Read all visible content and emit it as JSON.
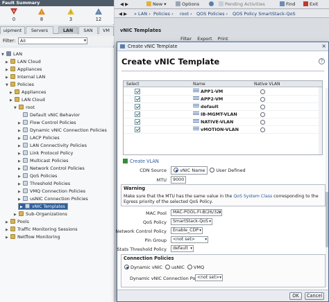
{
  "fault_summary": {
    "title": "Fault Summary",
    "items": [
      {
        "icon": "critical-icon",
        "count": "0",
        "color": "#c0392b"
      },
      {
        "icon": "major-icon",
        "count": "8",
        "color": "#e08a1e"
      },
      {
        "icon": "minor-icon",
        "count": "3",
        "color": "#e6c12a"
      },
      {
        "icon": "warning-icon",
        "count": "12",
        "color": "#5a7fae"
      }
    ]
  },
  "nav_tabs": [
    "uipment",
    "Servers",
    "LAN",
    "SAN",
    "VM"
  ],
  "active_tab": "LAN",
  "filter": {
    "label": "Filter:",
    "value": "All"
  },
  "tree": [
    {
      "label": "LAN",
      "icon": "root-icon"
    },
    {
      "label": "LAN Cloud",
      "icon": "folder-icon"
    },
    {
      "label": "Appliances",
      "icon": "folder-icon"
    },
    {
      "label": "Internal LAN",
      "icon": "folder-icon"
    },
    {
      "label": "Policies",
      "icon": "folder-icon"
    },
    {
      "label": "Appliances",
      "icon": "folder-icon"
    },
    {
      "label": "LAN Cloud",
      "icon": "folder-icon"
    },
    {
      "label": "root",
      "icon": "folder-icon"
    },
    {
      "label": "Default vNIC Behavior",
      "icon": "policy-icon"
    },
    {
      "label": "Flow Control Policies",
      "icon": "policy-icon"
    },
    {
      "label": "Dynamic vNIC Connection Policies",
      "icon": "policy-icon"
    },
    {
      "label": "LACP Policies",
      "icon": "policy-icon"
    },
    {
      "label": "LAN Connectivity Policies",
      "icon": "policy-icon"
    },
    {
      "label": "Link Protocol Policy",
      "icon": "policy-icon"
    },
    {
      "label": "Multicast Policies",
      "icon": "policy-icon"
    },
    {
      "label": "Network Control Policies",
      "icon": "policy-icon"
    },
    {
      "label": "QoS Policies",
      "icon": "policy-icon"
    },
    {
      "label": "Threshold Policies",
      "icon": "policy-icon"
    },
    {
      "label": "VMQ Connection Policies",
      "icon": "policy-icon"
    },
    {
      "label": "usNIC Connection Policies",
      "icon": "policy-icon"
    },
    {
      "label": "vNIC Templates",
      "icon": "policy-icon"
    },
    {
      "label": "Sub-Organizations",
      "icon": "folder-icon"
    },
    {
      "label": "Pools",
      "icon": "folder-icon"
    },
    {
      "label": "Traffic Monitoring Sessions",
      "icon": "folder-icon"
    },
    {
      "label": "Netflow Monitoring",
      "icon": "folder-icon"
    }
  ],
  "toolbar": {
    "new": "New",
    "options": "Options",
    "pending": "Pending Activities",
    "find": "Find",
    "exit": "Exit"
  },
  "breadcrumb": [
    "LAN",
    "Policies",
    "root",
    "QOS Policies",
    "QOS Policy SmartStack-QoS"
  ],
  "right_pane": {
    "title": "vNIC Templates",
    "actions": [
      "Filter",
      "Export",
      "Print"
    ]
  },
  "dialog": {
    "titlebar": "Create vNIC Template",
    "heading": "Create vNIC Template",
    "help": "?",
    "close": "×",
    "vlan_table": {
      "headers": [
        "Select",
        "Name",
        "Native VLAN"
      ],
      "rows": [
        {
          "name": "APP1-VM",
          "selected": true
        },
        {
          "name": "APP2-VM",
          "selected": true
        },
        {
          "name": "default",
          "selected": true
        },
        {
          "name": "IB-MGMT-VLAN",
          "selected": true
        },
        {
          "name": "NATIVE-VLAN",
          "selected": true
        },
        {
          "name": "vMOTION-VLAN",
          "selected": true
        }
      ]
    },
    "create_vlan": "Create VLAN",
    "cdn_source": {
      "label": "CDN Source",
      "options": [
        "vNIC Name",
        "User Defined"
      ],
      "selected": "vNIC Name"
    },
    "mtu": {
      "label": "MTU",
      "value": "9000"
    },
    "warning": {
      "title": "Warning",
      "text_before": "Make sure that the MTU has the same value in the ",
      "link": "QoS System Class",
      "text_after": " corresponding to the Egress priority of the selected QoS Policy."
    },
    "mac_pool": {
      "label": "MAC Pool",
      "value": "MAC-POOL-FI-B(26/32)"
    },
    "qos_policy": {
      "label": "QoS Policy",
      "value": "SmartStack-QoS"
    },
    "network_control_policy": {
      "label": "Network Control Policy",
      "value": "Enable_CDP"
    },
    "pin_group": {
      "label": "Pin Group",
      "value": "<not set>"
    },
    "stats_threshold_policy": {
      "label": "Stats Threshold Policy",
      "value": "default"
    },
    "connection_policies": {
      "title": "Connection Policies",
      "options": [
        "Dynamic vNIC",
        "usNIC",
        "VMQ"
      ],
      "selected": "Dynamic vNIC",
      "dynamic_label": "Dynamic vNIC Connection Policy",
      "dynamic_value": "<not set>"
    },
    "ok": "OK",
    "cancel": "Cancel"
  }
}
